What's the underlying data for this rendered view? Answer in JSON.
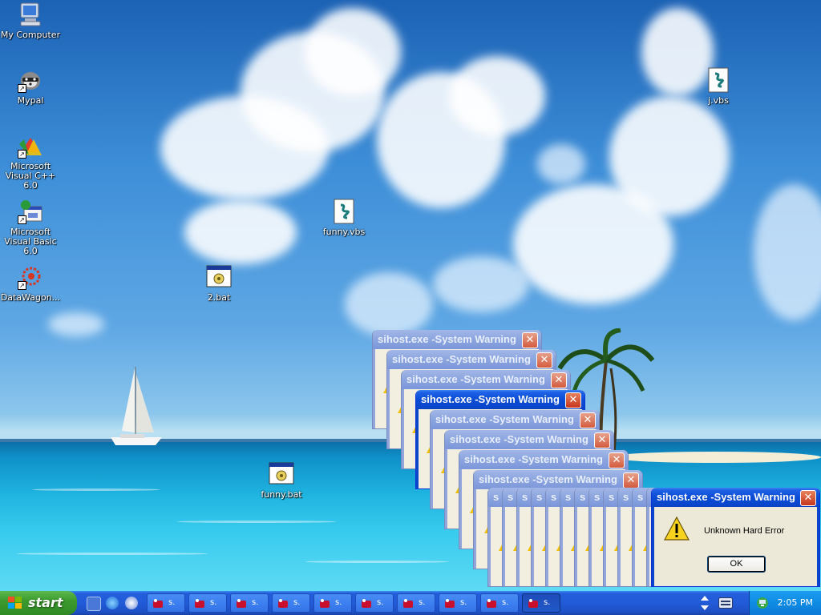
{
  "desktop": {
    "icons": [
      {
        "label": "My Computer",
        "icon": "my-computer-icon"
      },
      {
        "label": "Mypal",
        "icon": "raccoon-browser-icon"
      },
      {
        "label": "Microsoft Visual C++ 6.0",
        "icon": "visual-cpp-icon"
      },
      {
        "label": "Microsoft Visual Basic 6.0",
        "icon": "visual-basic-icon"
      },
      {
        "label": "DataWagon...",
        "icon": "datawagon-icon"
      },
      {
        "label": "2.bat",
        "icon": "batch-file-icon"
      },
      {
        "label": "funny.vbs",
        "icon": "vbscript-file-icon"
      },
      {
        "label": "j.vbs",
        "icon": "vbscript-file-icon"
      },
      {
        "label": "funny.bat",
        "icon": "batch-file-icon"
      }
    ]
  },
  "dialogs": {
    "title": "sihost.exe -System Warning",
    "close_glyph": "✕",
    "message": "Unknown Hard Error",
    "ok_label": "OK",
    "stacked_count_main": 8,
    "stacked_count_narrow": 12
  },
  "taskbar": {
    "start_label": "start",
    "quick_launch": [
      "show-desktop-icon",
      "internet-explorer-icon",
      "media-player-icon"
    ],
    "button_label": "s.",
    "button_count": 10,
    "clock": "2:05 PM"
  },
  "colors": {
    "titlebar_active": "#0a46cc",
    "titlebar_inactive": "#8ea7e0",
    "start_green": "#3c9a2f",
    "taskbar_blue": "#245edc",
    "tray_blue": "#0f8be4"
  }
}
